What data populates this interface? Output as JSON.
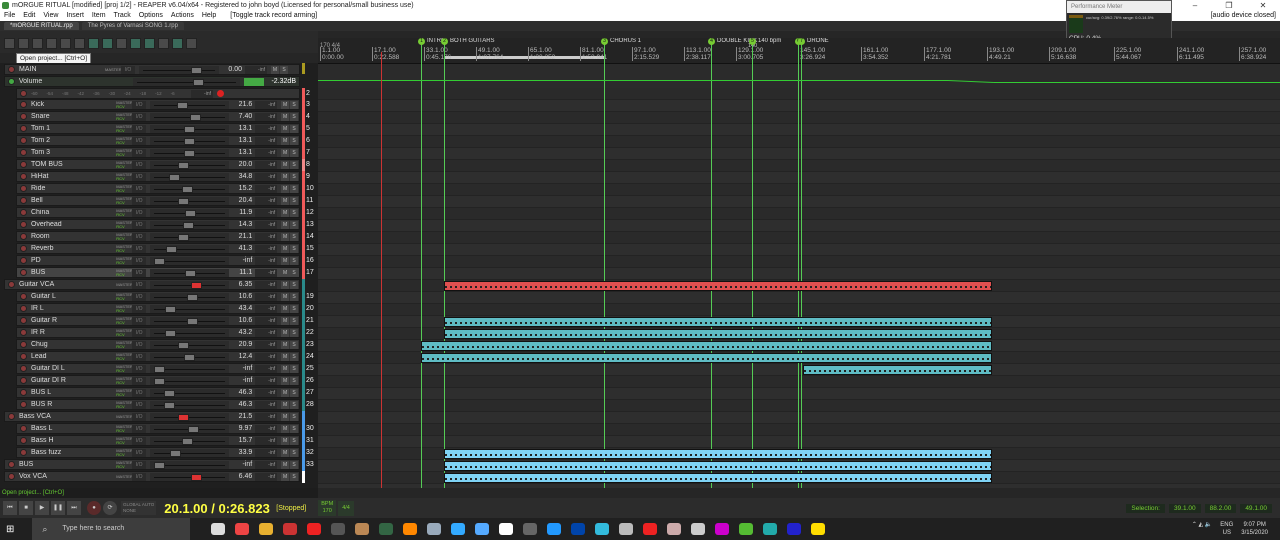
{
  "window": {
    "title": "mORGUE RITUAL [modified] [proj 1/2] - REAPER v6.04/x64 - Registered to john boyd (Licensed for personal/small business use)",
    "controls": [
      "–",
      "❐",
      "✕"
    ]
  },
  "menu": {
    "items": [
      "File",
      "Edit",
      "View",
      "Insert",
      "Item",
      "Track",
      "Options",
      "Actions",
      "Help"
    ],
    "action_hint": "[Toggle track record arming]",
    "right_status": "[audio device closed]"
  },
  "tabs": [
    {
      "label": "*mORGUE RITUAL.rpp",
      "active": true
    },
    {
      "label": "The Pyres of Varnasi SONG 1.rpp",
      "active": false
    }
  ],
  "toolbar": {
    "tooltip": "Open project... [Ctrl+O]",
    "icons": [
      "new-project",
      "open-project",
      "save-project",
      "settings",
      "undo",
      "redo",
      "snap",
      "grid",
      "metronome",
      "ripple",
      "cut",
      "envelope",
      "midi",
      "lock"
    ]
  },
  "performance_meter": {
    "title": "Performance Meter",
    "stats": "cur/avg: 0.39/2.76%  range: 0.0-14.5%",
    "cpu": "CPU: 0.4%"
  },
  "master": {
    "name": "MAIN",
    "value": "0.00",
    "peak": "-inf"
  },
  "volume_envelope": {
    "name": "Volume",
    "value": "-2.32dB"
  },
  "envelope_row": {
    "scale": [
      "-60",
      "-54",
      "-48",
      "-42",
      "-36",
      "-30",
      "-24",
      "-18",
      "-12",
      "-6"
    ],
    "peak": "-inf",
    "number": "2"
  },
  "tracks": [
    {
      "name": "Kick",
      "value": "21.6",
      "num": "3",
      "color": "#f05a5a",
      "level": 1,
      "pos": 0.38
    },
    {
      "name": "Snare",
      "value": "7.40",
      "num": "4",
      "color": "#f05a5a",
      "level": 1,
      "pos": 0.6
    },
    {
      "name": "Tom 1",
      "value": "13.1",
      "num": "5",
      "color": "#f05a5a",
      "level": 1,
      "pos": 0.5
    },
    {
      "name": "Tom 2",
      "value": "13.1",
      "num": "6",
      "color": "#f05a5a",
      "level": 1,
      "pos": 0.5
    },
    {
      "name": "Tom 3",
      "value": "13.1",
      "num": "7",
      "color": "#f05a5a",
      "level": 1,
      "pos": 0.5
    },
    {
      "name": "TOM BUS",
      "value": "20.0",
      "num": "8",
      "color": "#f08a8a",
      "level": 1,
      "pos": 0.4
    },
    {
      "name": "HiHat",
      "value": "34.8",
      "num": "9",
      "color": "#f05a5a",
      "level": 1,
      "pos": 0.25
    },
    {
      "name": "Ride",
      "value": "15.2",
      "num": "10",
      "color": "#f05a5a",
      "level": 1,
      "pos": 0.47
    },
    {
      "name": "Bell",
      "value": "20.4",
      "num": "11",
      "color": "#f05a5a",
      "level": 1,
      "pos": 0.4
    },
    {
      "name": "China",
      "value": "11.9",
      "num": "12",
      "color": "#f05a5a",
      "level": 1,
      "pos": 0.52
    },
    {
      "name": "Overhead",
      "value": "14.3",
      "num": "13",
      "color": "#f05a5a",
      "level": 1,
      "pos": 0.48
    },
    {
      "name": "Room",
      "value": "21.1",
      "num": "14",
      "color": "#f05a5a",
      "level": 1,
      "pos": 0.4
    },
    {
      "name": "Reverb",
      "value": "41.3",
      "num": "15",
      "color": "#f05a5a",
      "level": 1,
      "pos": 0.2
    },
    {
      "name": "PD",
      "value": "-inf",
      "num": "16",
      "color": "#f05a5a",
      "level": 1,
      "pos": 0.0
    },
    {
      "name": "BUS",
      "value": "11.1",
      "num": "17",
      "color": "#f05a5a",
      "level": 1,
      "pos": 0.52
    },
    {
      "name": "Guitar VCA",
      "value": "6.35",
      "num": "",
      "color": "#2a8a8a",
      "level": 0,
      "pos": 0.62,
      "vca": true
    },
    {
      "name": "Guitar L",
      "value": "10.6",
      "num": "19",
      "color": "#2a8a8a",
      "level": 1,
      "pos": 0.55
    },
    {
      "name": "IR L",
      "value": "43.4",
      "num": "20",
      "color": "#2a8a8a",
      "level": 1,
      "pos": 0.18
    },
    {
      "name": "Guitar R",
      "value": "10.6",
      "num": "21",
      "color": "#2a8a8a",
      "level": 1,
      "pos": 0.55
    },
    {
      "name": "IR R",
      "value": "43.2",
      "num": "22",
      "color": "#2a8a8a",
      "level": 1,
      "pos": 0.18
    },
    {
      "name": "Chug",
      "value": "20.9",
      "num": "23",
      "color": "#2a8a8a",
      "level": 1,
      "pos": 0.4
    },
    {
      "name": "Lead",
      "value": "12.4",
      "num": "24",
      "color": "#2a8a8a",
      "level": 1,
      "pos": 0.5
    },
    {
      "name": "Guitar DI L",
      "value": "-inf",
      "num": "25",
      "color": "#2a8a8a",
      "level": 1,
      "pos": 0.0
    },
    {
      "name": "Guitar DI R",
      "value": "-inf",
      "num": "26",
      "color": "#2a8a8a",
      "level": 1,
      "pos": 0.0
    },
    {
      "name": "BUS L",
      "value": "46.3",
      "num": "27",
      "color": "#2a8a8a",
      "level": 1,
      "pos": 0.17
    },
    {
      "name": "BUS R",
      "value": "46.3",
      "num": "28",
      "color": "#2a8a8a",
      "level": 1,
      "pos": 0.17
    },
    {
      "name": "Bass VCA",
      "value": "21.5",
      "num": "",
      "color": "#4a9ae8",
      "level": 0,
      "pos": 0.4,
      "vca": true
    },
    {
      "name": "Bass L",
      "value": "9.97",
      "num": "30",
      "color": "#4a9ae8",
      "level": 1,
      "pos": 0.57
    },
    {
      "name": "Bass H",
      "value": "15.7",
      "num": "31",
      "color": "#4a9ae8",
      "level": 1,
      "pos": 0.47
    },
    {
      "name": "Bass fuzz",
      "value": "33.9",
      "num": "32",
      "color": "#4a9ae8",
      "level": 1,
      "pos": 0.27
    },
    {
      "name": "BUS",
      "value": "-inf",
      "num": "33",
      "color": "#4a9ae8",
      "level": 0,
      "pos": 0.0
    },
    {
      "name": "Vox VCA",
      "value": "6.46",
      "num": "",
      "color": "#ffffff",
      "level": 0,
      "pos": 0.62,
      "vca": true
    }
  ],
  "ruler": {
    "tempo_sig": "170 4/4",
    "bars": [
      {
        "bar": "1.1.00",
        "time": "0:00.00"
      },
      {
        "bar": "17.1.00",
        "time": "0:22.588"
      },
      {
        "bar": "33.1.00",
        "time": "0:45.176"
      },
      {
        "bar": "49.1.00",
        "time": "1:07.764"
      },
      {
        "bar": "65.1.00",
        "time": "1:30.352"
      },
      {
        "bar": "81.1.00",
        "time": "1:52.941"
      },
      {
        "bar": "97.1.00",
        "time": "2:15.529"
      },
      {
        "bar": "113.1.00",
        "time": "2:38.117"
      },
      {
        "bar": "129.1.00",
        "time": "3:00.705"
      },
      {
        "bar": "145.1.00",
        "time": "3:26.924"
      },
      {
        "bar": "161.1.00",
        "time": "3:54.352"
      },
      {
        "bar": "177.1.00",
        "time": "4:21.781"
      },
      {
        "bar": "193.1.00",
        "time": "4:49.21"
      },
      {
        "bar": "209.1.00",
        "time": "5:16.638"
      },
      {
        "bar": "225.1.00",
        "time": "5:44.067"
      },
      {
        "bar": "241.1.00",
        "time": "6:11.495"
      },
      {
        "bar": "257.1.00",
        "time": "6:38.924"
      }
    ],
    "tempo_marker": "140"
  },
  "markers": [
    {
      "num": "1",
      "label": "INTRO"
    },
    {
      "num": "2",
      "label": "BOTH GUITARS"
    },
    {
      "num": "3",
      "label": "CHORUS 1"
    },
    {
      "num": "4",
      "label": "DOUBLE KICK"
    },
    {
      "num": "5",
      "label": "140 bpm"
    },
    {
      "num": "6",
      "label": ""
    },
    {
      "num": "7",
      "label": "DRONE"
    }
  ],
  "status": "Open project... [Ctrl+O]",
  "transport": {
    "buttons": [
      "go-start",
      "stop",
      "play",
      "pause",
      "go-end",
      "record",
      "repeat"
    ],
    "global_auto": "GLOBAL AUTO",
    "global_auto_mode": "NONE",
    "clock": "20.1.00 / 0:26.823",
    "state": "[Stopped]",
    "bpm_label": "BPM",
    "bpm": "170",
    "time_sig": "4/4"
  },
  "selection": {
    "label": "Selection:",
    "start": "39.1.00",
    "end": "88.2.00",
    "length": "49.1.00"
  },
  "taskbar": {
    "search_placeholder": "Type here to search",
    "apps": [
      "cortana",
      "chrome",
      "file-explorer",
      "ccleaner",
      "flashpoint",
      "reaper",
      "app-a",
      "app-b",
      "app-c",
      "app-d",
      "app-e",
      "waves",
      "ableton-like",
      "app-f",
      "photoshop",
      "app-g",
      "app-h",
      "app-i",
      "app-j",
      "app-k",
      "utorrent",
      "app-l",
      "app-m",
      "sticky-notes",
      "firefox",
      "itunes"
    ],
    "lang": "ENG",
    "region": "US",
    "time": "9:07 PM",
    "date": "3/15/2020"
  },
  "colors": {
    "drums": "#f05a5a",
    "guitars": "#2a8a8a",
    "bass": "#4a9ae8",
    "accent": "#66cc33"
  }
}
